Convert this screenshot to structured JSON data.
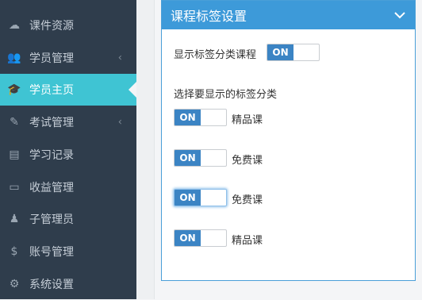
{
  "sidebar": {
    "items": [
      {
        "label": "课件资源",
        "icon": "cloud-upload-icon",
        "glyph": "☁",
        "has_chevron": false
      },
      {
        "label": "学员管理",
        "icon": "users-icon",
        "glyph": "👥",
        "has_chevron": true
      },
      {
        "label": "学员主页",
        "icon": "graduation-cap-icon",
        "glyph": "🎓",
        "has_chevron": false,
        "active": true
      },
      {
        "label": "考试管理",
        "icon": "stethoscope-icon",
        "glyph": "✎",
        "has_chevron": true
      },
      {
        "label": "学习记录",
        "icon": "book-icon",
        "glyph": "▤",
        "has_chevron": false
      },
      {
        "label": "收益管理",
        "icon": "credit-card-icon",
        "glyph": "▭",
        "has_chevron": false
      },
      {
        "label": "子管理员",
        "icon": "user-secret-icon",
        "glyph": "♟",
        "has_chevron": false
      },
      {
        "label": "账号管理",
        "icon": "dollar-icon",
        "glyph": "$",
        "has_chevron": false
      },
      {
        "label": "系统设置",
        "icon": "gear-icon",
        "glyph": "⚙",
        "has_chevron": false
      }
    ],
    "chevron_glyph": "‹"
  },
  "panel": {
    "title": "课程标签设置",
    "show_tag_label": "显示标签分类课程",
    "select_tags_label": "选择要显示的标签分类",
    "toggle_on_text": "ON",
    "tags": [
      {
        "label": "精品课",
        "state": "ON"
      },
      {
        "label": "免费课",
        "state": "ON"
      },
      {
        "label": "免费课",
        "state": "ON",
        "focused": true
      },
      {
        "label": "精品课",
        "state": "ON"
      }
    ]
  },
  "colors": {
    "sidebar_bg": "#2f3d4c",
    "active_bg": "#3fc4d3",
    "header_bg": "#3d9ad9",
    "toggle_on_bg": "#3b84c4"
  }
}
